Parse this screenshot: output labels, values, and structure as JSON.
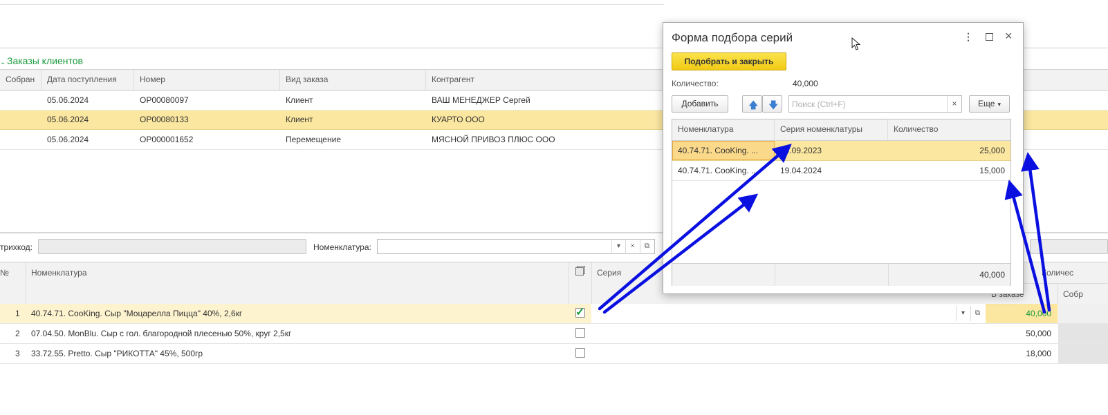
{
  "orders_section": {
    "title": "Заказы клиентов"
  },
  "orders_table": {
    "columns": [
      "Собран",
      "Дата поступления",
      "Номер",
      "Вид заказа",
      "Контрагент"
    ],
    "rows": [
      {
        "date": "05.06.2024",
        "number": "ОР00080097",
        "type": "Клиент",
        "counterparty": "ВАШ МЕНЕДЖЕР Сергей"
      },
      {
        "date": "05.06.2024",
        "number": "ОР00080133",
        "type": "Клиент",
        "counterparty": "КУАРТО ООО"
      },
      {
        "date": "05.06.2024",
        "number": "ОР000001652",
        "type": "Перемещение",
        "counterparty": "МЯСНОЙ ПРИВОЗ ПЛЮС ООО"
      }
    ]
  },
  "filter_bar": {
    "barcode_label": "трихкод:",
    "nomenclature_label": "Номенклатура:"
  },
  "items_table": {
    "col_no": "№",
    "col_nomenclature": "Номенклатура",
    "col_series": "Серия",
    "col_quantity": "Количес",
    "sub_in_order": "В заказе",
    "sub_collected": "Собр",
    "rows": [
      {
        "no": "1",
        "name": "40.74.71. CooKing. Сыр \"Моцарелла Пицца\" 40%, 2,6кг",
        "checked": true,
        "qty": "40,000"
      },
      {
        "no": "2",
        "name": "07.04.50. MonBlu. Сыр с гол. благородной плесенью 50%, круг 2,5кг",
        "checked": false,
        "qty": "50,000"
      },
      {
        "no": "3",
        "name": "33.72.55. Pretto. Сыр \"РИКОТТА\" 45%, 500гр",
        "checked": false,
        "qty": "18,000"
      }
    ]
  },
  "dialog": {
    "title": "Форма подбора серий",
    "pick_close_button": "Подобрать и закрыть",
    "quantity_label": "Количество:",
    "quantity_value": "40,000",
    "add_button": "Добавить",
    "search_placeholder": "Поиск (Ctrl+F)",
    "more_button": "Еще",
    "columns": [
      "Номенклатура",
      "Серия номенклатуры",
      "Количество"
    ],
    "rows": [
      {
        "nomenclature": "40.74.71. CooKing. ...",
        "series": "29.09.2023",
        "quantity": "25,000"
      },
      {
        "nomenclature": "40.74.71. CooKing. ...",
        "series": "19.04.2024",
        "quantity": "15,000"
      }
    ],
    "total": "40,000"
  },
  "icons": [
    "check-icon",
    "up-arrow-icon",
    "down-arrow-icon",
    "clear-icon",
    "kebab-menu-icon",
    "maximize-icon",
    "close-icon",
    "dropdown-icon",
    "open-icon",
    "mouse-cursor-icon"
  ],
  "colors": {
    "accent_green": "#1a9b3c",
    "selected_row": "#fbeeb4",
    "primary_button": "#f7d52e",
    "annotation_arrow": "#0a10e0"
  }
}
